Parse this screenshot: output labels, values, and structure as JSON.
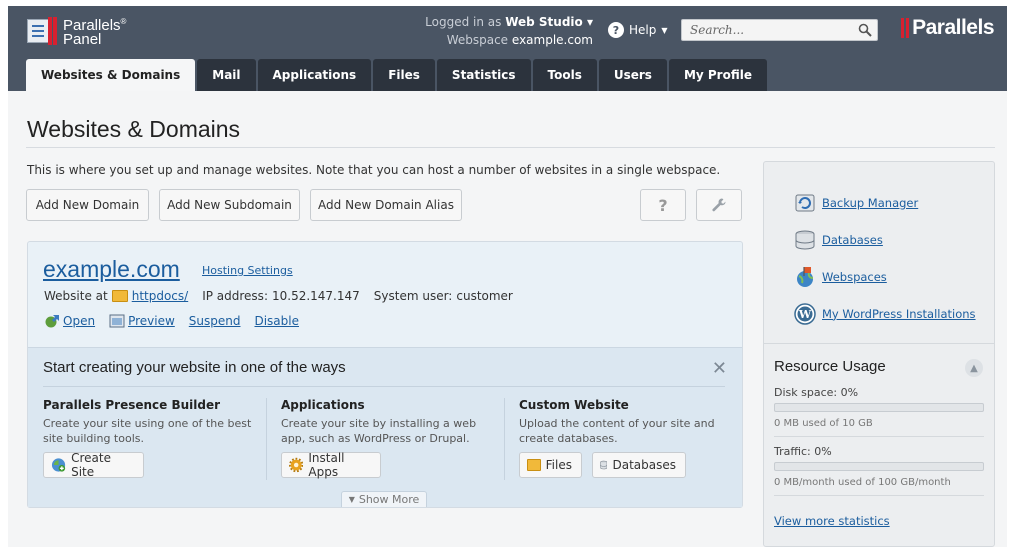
{
  "header": {
    "logo_line1": "Parallels",
    "logo_line2": "Panel",
    "logged_in_label": "Logged in as",
    "logged_in_user": "Web Studio",
    "webspace_label": "Webspace",
    "webspace_value": "example.com",
    "help_label": "Help",
    "search_placeholder": "Search...",
    "brand": "Parallels"
  },
  "tabs": [
    {
      "label": "Websites & Domains",
      "active": true
    },
    {
      "label": "Mail"
    },
    {
      "label": "Applications"
    },
    {
      "label": "Files"
    },
    {
      "label": "Statistics"
    },
    {
      "label": "Tools"
    },
    {
      "label": "Users"
    },
    {
      "label": "My Profile"
    }
  ],
  "page": {
    "title": "Websites & Domains",
    "intro": "This is where you set up and manage websites. Note that you can host a number of websites in a single webspace.",
    "buttons": {
      "add_domain": "Add New Domain",
      "add_subdomain": "Add New Subdomain",
      "add_alias": "Add New Domain Alias",
      "help": "?"
    }
  },
  "domain": {
    "name": "example.com",
    "hosting_settings": "Hosting Settings",
    "website_at_label": "Website at",
    "docroot": "httpdocs/",
    "ip_label": "IP address:",
    "ip": "10.52.147.147",
    "sysuser_label": "System user:",
    "sysuser": "customer",
    "actions": {
      "open": "Open",
      "preview": "Preview",
      "suspend": "Suspend",
      "disable": "Disable"
    }
  },
  "start": {
    "title": "Start creating your website in one of the ways",
    "close": "✕",
    "columns": [
      {
        "heading": "Parallels Presence Builder",
        "text": "Create your site using one of the best site building tools.",
        "button": "Create Site"
      },
      {
        "heading": "Applications",
        "text": "Create your site by installing a web app, such as WordPress or Drupal.",
        "button": "Install Apps"
      },
      {
        "heading": "Custom Website",
        "text": "Upload the content of your site and create databases.",
        "button_files": "Files",
        "button_databases": "Databases"
      }
    ],
    "show_more": "Show More"
  },
  "sidebar": {
    "links": [
      {
        "label": "Backup Manager"
      },
      {
        "label": "Databases"
      },
      {
        "label": "Webspaces"
      },
      {
        "label": "My WordPress Installations"
      }
    ],
    "resource": {
      "title": "Resource Usage",
      "disk_label": "Disk space: 0%",
      "disk_value": 0,
      "disk_sub": "0 MB used of 10 GB",
      "traffic_label": "Traffic: 0%",
      "traffic_value": 0,
      "traffic_sub": "0 MB/month used of 100 GB/month",
      "more": "View more statistics"
    }
  }
}
